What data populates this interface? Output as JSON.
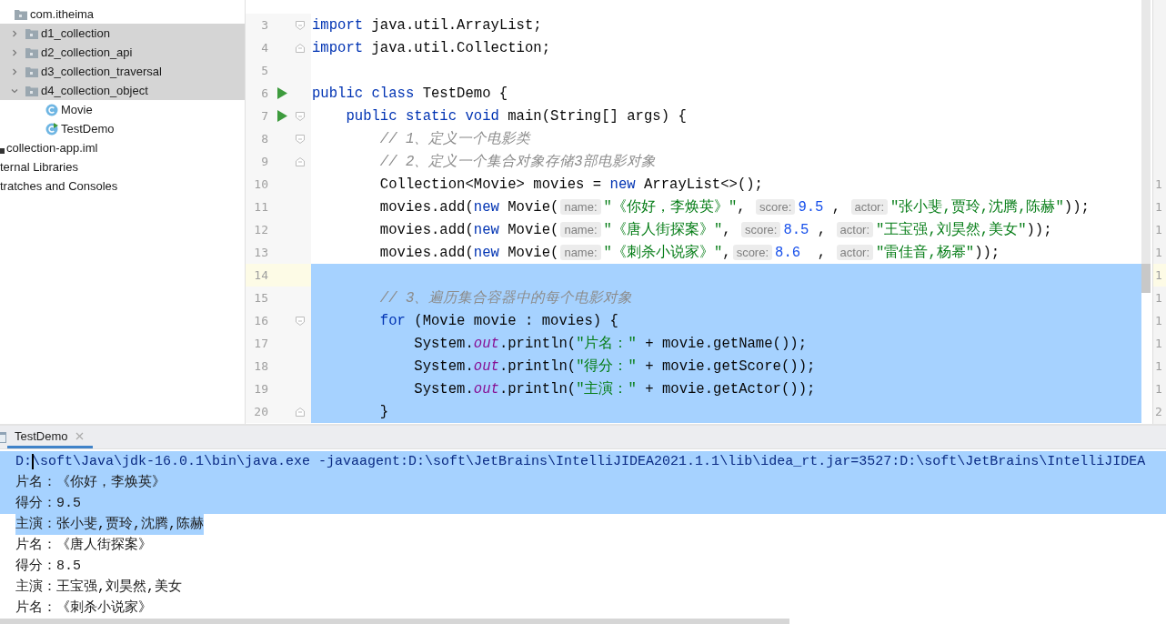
{
  "sidebar": {
    "tree": [
      {
        "label": "com.itheima",
        "kind": "package",
        "selected": false,
        "children": [
          {
            "label": "d1_collection",
            "kind": "package",
            "expanded": false,
            "selected": true
          },
          {
            "label": "d2_collection_api",
            "kind": "package",
            "expanded": false,
            "selected": true
          },
          {
            "label": "d3_collection_traversal",
            "kind": "package",
            "expanded": false,
            "selected": true
          },
          {
            "label": "d4_collection_object",
            "kind": "package",
            "expanded": true,
            "selected": true,
            "children": [
              {
                "label": "Movie",
                "kind": "class",
                "selected": false
              },
              {
                "label": "TestDemo",
                "kind": "runnable_class",
                "selected": false
              }
            ]
          }
        ]
      }
    ],
    "root_items": [
      {
        "label": "collection-app.iml",
        "kind": "iml"
      },
      {
        "label": "ternal Libraries",
        "kind": "plain"
      },
      {
        "label": "tratches and Consoles",
        "kind": "plain"
      }
    ]
  },
  "editor": {
    "lines": [
      {
        "number": "3",
        "fold": {
          "kind": "start"
        },
        "tokens": [
          {
            "kind": "kw",
            "s": "import"
          },
          {
            "kind": "plain",
            "s": " java.util.ArrayList;"
          }
        ]
      },
      {
        "number": "4",
        "fold": {
          "kind": "end"
        },
        "tokens": [
          {
            "kind": "kw",
            "s": "import"
          },
          {
            "kind": "plain",
            "s": " java.util.Collection;"
          }
        ]
      },
      {
        "number": "5"
      },
      {
        "number": "6",
        "run": true,
        "tokens": [
          {
            "kind": "kw",
            "s": "public class"
          },
          {
            "kind": "plain",
            "s": " TestDemo {"
          }
        ]
      },
      {
        "number": "7",
        "run": true,
        "fold": {
          "kind": "start"
        },
        "tokens": [
          {
            "kind": "kw",
            "s": "    public static void"
          },
          {
            "kind": "plain",
            "s": " main(String[] args) {"
          }
        ]
      },
      {
        "number": "8",
        "fold": {
          "kind": "start"
        },
        "tokens": [
          {
            "kind": "comment",
            "s": "        // 1、定义一个电影类"
          }
        ]
      },
      {
        "number": "9",
        "fold": {
          "kind": "end"
        },
        "tokens": [
          {
            "kind": "comment",
            "s": "        // 2、定义一个集合对象存储3部电影对象"
          }
        ]
      },
      {
        "number": "10",
        "right_number": "1",
        "tokens": [
          {
            "kind": "plain",
            "s": "        Collection<Movie> movies = "
          },
          {
            "kind": "kw",
            "s": "new"
          },
          {
            "kind": "plain",
            "s": " ArrayList<>();"
          }
        ]
      },
      {
        "number": "11",
        "right_number": "1",
        "tokens": [
          {
            "kind": "plain",
            "s": "        movies.add("
          },
          {
            "kind": "kw",
            "s": "new"
          },
          {
            "kind": "plain",
            "s": " Movie("
          },
          {
            "kind": "hint",
            "s": "name:"
          },
          {
            "kind": "str",
            "s": "\"《你好，李焕英》\""
          },
          {
            "kind": "plain",
            "s": ", "
          },
          {
            "kind": "hint",
            "s": "score:"
          },
          {
            "kind": "num",
            "s": "9.5"
          },
          {
            "kind": "plain",
            "s": " , "
          },
          {
            "kind": "hint",
            "s": "actor:"
          },
          {
            "kind": "str",
            "s": "\"张小斐,贾玲,沈腾,陈赫\""
          },
          {
            "kind": "plain",
            "s": "));"
          }
        ]
      },
      {
        "number": "12",
        "right_number": "1",
        "tokens": [
          {
            "kind": "plain",
            "s": "        movies.add("
          },
          {
            "kind": "kw",
            "s": "new"
          },
          {
            "kind": "plain",
            "s": " Movie("
          },
          {
            "kind": "hint",
            "s": "name:"
          },
          {
            "kind": "str",
            "s": "\"《唐人街探案》\""
          },
          {
            "kind": "plain",
            "s": ", "
          },
          {
            "kind": "hint",
            "s": "score:"
          },
          {
            "kind": "num",
            "s": "8.5"
          },
          {
            "kind": "plain",
            "s": " , "
          },
          {
            "kind": "hint",
            "s": "actor:"
          },
          {
            "kind": "str",
            "s": "\"王宝强,刘昊然,美女\""
          },
          {
            "kind": "plain",
            "s": "));"
          }
        ]
      },
      {
        "number": "13",
        "right_number": "1",
        "tokens": [
          {
            "kind": "plain",
            "s": "        movies.add("
          },
          {
            "kind": "kw",
            "s": "new"
          },
          {
            "kind": "plain",
            "s": " Movie("
          },
          {
            "kind": "hint",
            "s": "name:"
          },
          {
            "kind": "str",
            "s": "\"《刺杀小说家》\""
          },
          {
            "kind": "plain",
            "s": ","
          },
          {
            "kind": "hint",
            "s": "score:"
          },
          {
            "kind": "num",
            "s": "8.6"
          },
          {
            "kind": "plain",
            "s": "  , "
          },
          {
            "kind": "hint",
            "s": "actor:"
          },
          {
            "kind": "str",
            "s": "\"雷佳音,杨幂\""
          },
          {
            "kind": "plain",
            "s": "));"
          }
        ]
      },
      {
        "number": "14",
        "right_number": "1",
        "current": true,
        "selected": true
      },
      {
        "number": "15",
        "right_number": "1",
        "selected": true,
        "tokens": [
          {
            "kind": "comment",
            "s": "        // 3、遍历集合容器中的每个电影对象"
          }
        ]
      },
      {
        "number": "16",
        "right_number": "1",
        "selected": true,
        "fold": {
          "kind": "start"
        },
        "tokens": [
          {
            "kind": "kw",
            "s": "        for"
          },
          {
            "kind": "plain",
            "s": " (Movie movie : movies) {"
          }
        ]
      },
      {
        "number": "17",
        "right_number": "1",
        "selected": true,
        "tokens": [
          {
            "kind": "plain",
            "s": "            System."
          },
          {
            "kind": "field",
            "s": "out"
          },
          {
            "kind": "plain",
            "s": ".println("
          },
          {
            "kind": "str",
            "s": "\"片名：\""
          },
          {
            "kind": "plain",
            "s": " + movie.getName());"
          }
        ]
      },
      {
        "number": "18",
        "right_number": "1",
        "selected": true,
        "tokens": [
          {
            "kind": "plain",
            "s": "            System."
          },
          {
            "kind": "field",
            "s": "out"
          },
          {
            "kind": "plain",
            "s": ".println("
          },
          {
            "kind": "str",
            "s": "\"得分：\""
          },
          {
            "kind": "plain",
            "s": " + movie.getScore());"
          }
        ]
      },
      {
        "number": "19",
        "right_number": "1",
        "selected": true,
        "tokens": [
          {
            "kind": "plain",
            "s": "            System."
          },
          {
            "kind": "field",
            "s": "out"
          },
          {
            "kind": "plain",
            "s": ".println("
          },
          {
            "kind": "str",
            "s": "\"主演：\""
          },
          {
            "kind": "plain",
            "s": " + movie.getActor());"
          }
        ]
      },
      {
        "number": "20",
        "right_number": "2",
        "selected": true,
        "fold": {
          "kind": "end"
        },
        "tokens": [
          {
            "kind": "plain",
            "s": "        }"
          }
        ]
      }
    ]
  },
  "run_panel": {
    "tabs": [
      {
        "label": "TestDemo",
        "selected": true
      }
    ],
    "console": [
      {
        "kind": "command",
        "text": "D:\\soft\\Java\\jdk-16.0.1\\bin\\java.exe -javaagent:D:\\soft\\JetBrains\\IntelliJIDEA2021.1.1\\lib\\idea_rt.jar=3527:D:\\soft\\JetBrains\\IntelliJIDEA",
        "selected": true,
        "caret": true
      },
      {
        "kind": "output",
        "text": "片名：《你好，李焕英》",
        "selected": true
      },
      {
        "kind": "output",
        "text": "得分：9.5",
        "selected": true
      },
      {
        "kind": "output",
        "text": "主演：张小斐,贾玲,沈腾,陈赫",
        "selected": true
      },
      {
        "kind": "output",
        "text": "片名：《唐人街探案》",
        "selected": false
      },
      {
        "kind": "output",
        "text": "得分：8.5",
        "selected": false
      },
      {
        "kind": "output",
        "text": "主演：王宝强,刘昊然,美女",
        "selected": false
      },
      {
        "kind": "output",
        "text": "片名：《刺杀小说家》",
        "selected": false
      }
    ]
  }
}
